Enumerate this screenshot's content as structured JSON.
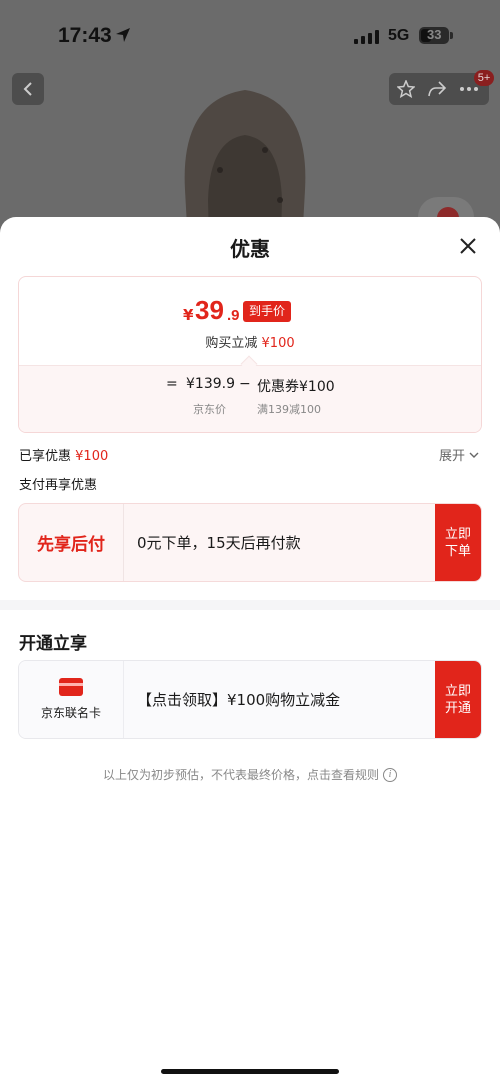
{
  "status_bar": {
    "time": "17:43",
    "network": "5G",
    "battery": "33"
  },
  "top_bar": {
    "badge": "5+"
  },
  "sheet": {
    "title": "优惠",
    "price": {
      "currency": "¥",
      "integer": "39",
      "decimal": ".9",
      "tag": "到手价"
    },
    "reduce": {
      "label": "购买立减",
      "amount": "¥100"
    },
    "formula": {
      "equals": "=",
      "base_price": "¥139.9",
      "minus": "−",
      "coupon": "优惠券¥100",
      "base_label": "京东价",
      "coupon_label": "满139减100"
    },
    "enjoyed": {
      "label": "已享优惠",
      "amount": "¥100"
    },
    "expand_label": "展开",
    "pay_more_label": "支付再享优惠",
    "pay_later": {
      "label": "先享后付",
      "text": "0元下单，15天后再付款",
      "button": "立即下单"
    },
    "section_title": "开通立享",
    "card_offer": {
      "icon": "credit-card-icon",
      "name": "京东联名卡",
      "text": "【点击领取】¥100购物立减金",
      "button": "立即开通"
    },
    "disclaimer": "以上仅为初步预估，不代表最终价格，点击查看规则"
  },
  "colors": {
    "accent": "#e1251b",
    "overlay": "#5f5f5f"
  }
}
